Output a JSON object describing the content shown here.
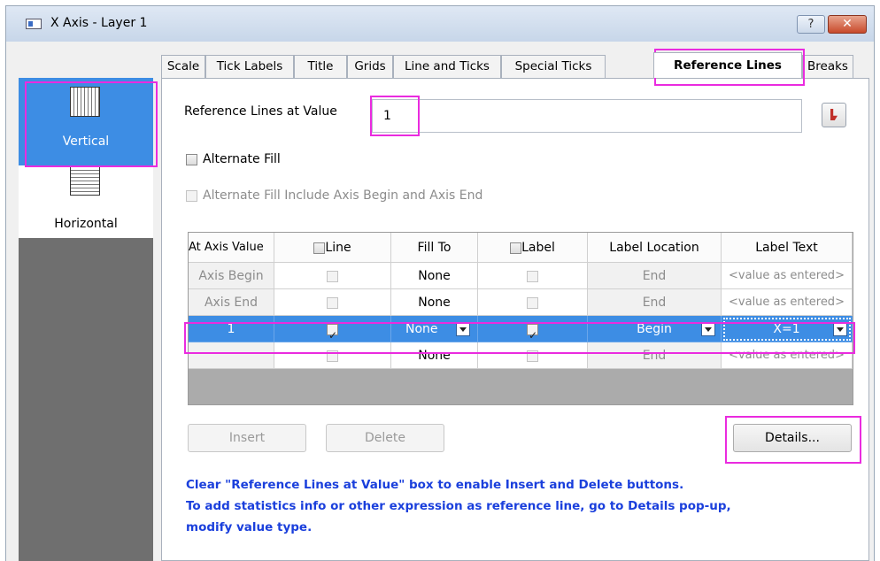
{
  "window": {
    "title": "X Axis - Layer 1",
    "help_glyph": "?",
    "close_glyph": "✕"
  },
  "sidebar": {
    "items": [
      {
        "label": "Vertical",
        "icon": "vertical-grid-icon",
        "selected": true
      },
      {
        "label": "Horizontal",
        "icon": "horizontal-grid-icon",
        "selected": false
      }
    ]
  },
  "tabs": [
    {
      "label": "Scale"
    },
    {
      "label": "Tick Labels"
    },
    {
      "label": "Title"
    },
    {
      "label": "Grids"
    },
    {
      "label": "Line and Ticks"
    },
    {
      "label": "Special Ticks"
    },
    {
      "label": "Reference Lines",
      "active": true
    },
    {
      "label": "Breaks"
    }
  ],
  "form": {
    "ref_lines_label": "Reference Lines at Value",
    "ref_lines_value": "1",
    "alt_fill_label": "Alternate Fill",
    "alt_fill_include_label": "Alternate Fill Include Axis Begin and Axis End"
  },
  "table": {
    "headers": {
      "axis_value": "At Axis Value",
      "line": "Line",
      "fill_to": "Fill To",
      "label": "Label",
      "label_location": "Label Location",
      "label_text": "Label Text"
    },
    "rows": [
      {
        "axis_value": "Axis Begin",
        "line": false,
        "fill_to": "None",
        "label": false,
        "label_location": "End",
        "label_text": "<value as entered>"
      },
      {
        "axis_value": "Axis End",
        "line": false,
        "fill_to": "None",
        "label": false,
        "label_location": "End",
        "label_text": "<value as entered>"
      },
      {
        "axis_value": "1",
        "line": true,
        "fill_to": "None",
        "label": true,
        "label_location": "Begin",
        "label_text": "X=1",
        "selected": true
      },
      {
        "axis_value": "",
        "line": false,
        "fill_to": "None",
        "label": false,
        "label_location": "End",
        "label_text": "<value as entered>"
      }
    ]
  },
  "buttons": {
    "insert": "Insert",
    "delete": "Delete",
    "details": "Details..."
  },
  "hints": [
    "Clear \"Reference Lines at Value\" box to enable Insert and Delete buttons.",
    "To add statistics info or other expression as reference line, go to Details pop-up,",
    "modify value type."
  ],
  "colors": {
    "selection": "#3d8de4",
    "highlight": "#ea2bdf",
    "hint_text": "#1a3fdc"
  }
}
